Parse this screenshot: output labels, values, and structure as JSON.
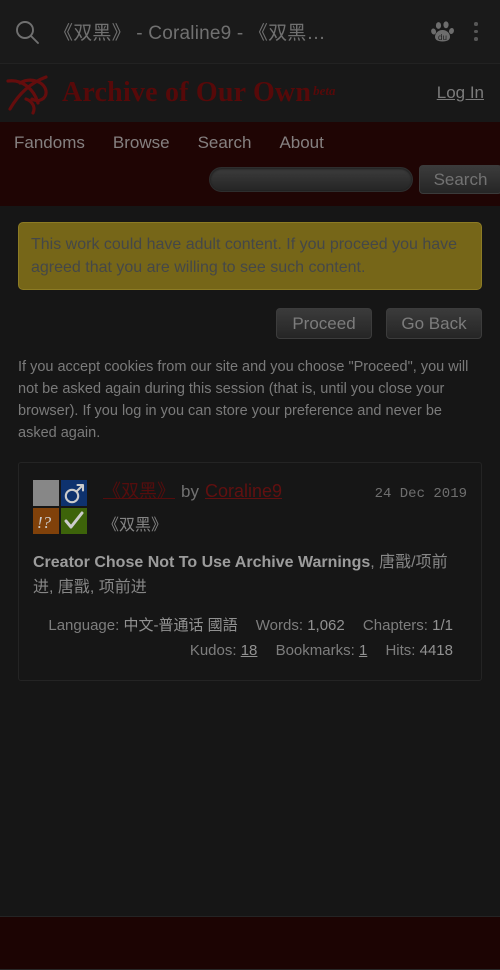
{
  "browser": {
    "search_icon": "search-icon",
    "url_text": "《双黑》 - Coraline9 - 《双黑…",
    "baidu_icon": "baidu-paw-icon",
    "menu_icon": "kebab-menu-icon"
  },
  "site_header": {
    "logo_icon": "ao3-logo-icon",
    "brand": "Archive of Our Own",
    "beta": "beta",
    "login": "Log In"
  },
  "nav": {
    "items": [
      {
        "label": "Fandoms"
      },
      {
        "label": "Browse"
      },
      {
        "label": "Search"
      },
      {
        "label": "About"
      }
    ],
    "search_value": "",
    "search_placeholder": "",
    "search_button": "Search"
  },
  "notice": {
    "text": "This work could have adult content. If you proceed you have agreed that you are willing to see such content.",
    "proceed": "Proceed",
    "go_back": "Go Back",
    "cookie_note": "If you accept cookies from our site and you choose \"Proceed\", you will not be asked again during this session (that is, until you close your browser). If you log in you can store your preference and never be asked again."
  },
  "work": {
    "required_tags": [
      {
        "name": "rating-not-rated-icon",
        "label": "Not Rated",
        "color": "#a9a9a9"
      },
      {
        "name": "category-mm-icon",
        "label": "M/M",
        "color": "#123f8a"
      },
      {
        "name": "warning-choose-not-to-use-icon",
        "label": "Choose Not To Use Archive Warnings",
        "color": "#a0520d"
      },
      {
        "name": "complete-work-icon",
        "label": "Complete Work",
        "color": "#4d7c0d"
      }
    ],
    "title": "《双黑》",
    "by": "by",
    "author": "Coraline9",
    "date": "24 Dec 2019",
    "fandom": "《双黑》",
    "warnings_strong": "Creator Chose Not To Use Archive Warnings",
    "warnings_rest": ", 唐戬/项前进, 唐戬, 项前进",
    "stats": {
      "language_label": "Language:",
      "language_value": "中文-普通话 國語",
      "words_label": "Words:",
      "words_value": "1,062",
      "chapters_label": "Chapters:",
      "chapters_value": "1/1",
      "kudos_label": "Kudos:",
      "kudos_value": "18",
      "bookmarks_label": "Bookmarks:",
      "bookmarks_value": "1",
      "hits_label": "Hits:",
      "hits_value": "4418"
    }
  },
  "colors": {
    "brand_red": "#6d0c0c",
    "nav_band": "#270706",
    "notice_bg": "#94801f",
    "page_bg": "#1c1c1c"
  }
}
